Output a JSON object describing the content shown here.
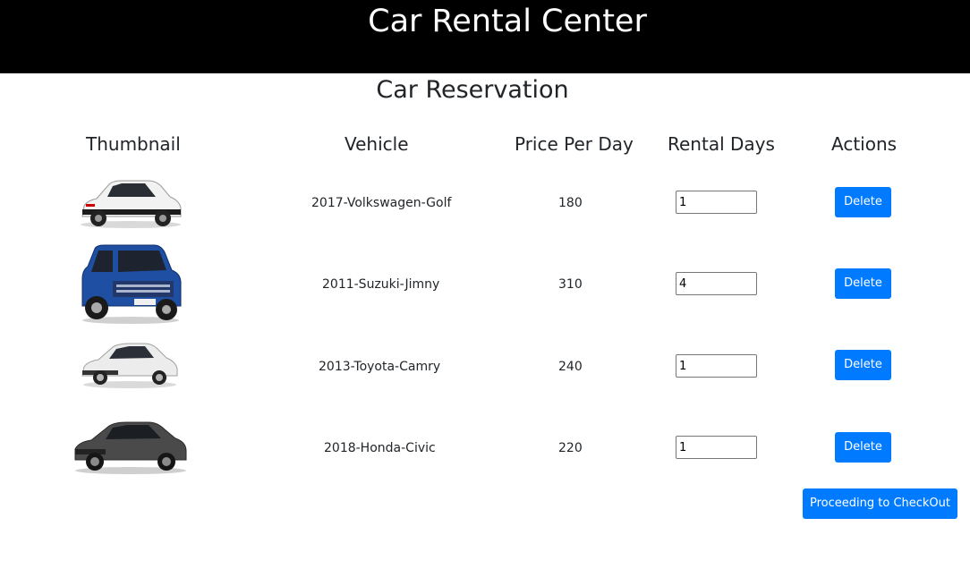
{
  "header": {
    "title": "Car Rental Center"
  },
  "page": {
    "title": "Car Reservation"
  },
  "table": {
    "columns": [
      "Thumbnail",
      "Vehicle",
      "Price Per Day",
      "Rental Days",
      "Actions"
    ],
    "rows": [
      {
        "vehicle": "2017-Volkswagen-Golf",
        "price": "180",
        "days": "1",
        "action": "Delete",
        "color": "#f2f2f2"
      },
      {
        "vehicle": "2011-Suzuki-Jimny",
        "price": "310",
        "days": "4",
        "action": "Delete",
        "color": "#1f4fa3"
      },
      {
        "vehicle": "2013-Toyota-Camry",
        "price": "240",
        "days": "1",
        "action": "Delete",
        "color": "#e8e8e8"
      },
      {
        "vehicle": "2018-Honda-Civic",
        "price": "220",
        "days": "1",
        "action": "Delete",
        "color": "#4a4a4a"
      }
    ]
  },
  "checkout": {
    "label": "Proceeding to CheckOut"
  },
  "colors": {
    "header_bg": "#000000",
    "button": "#007bff"
  }
}
